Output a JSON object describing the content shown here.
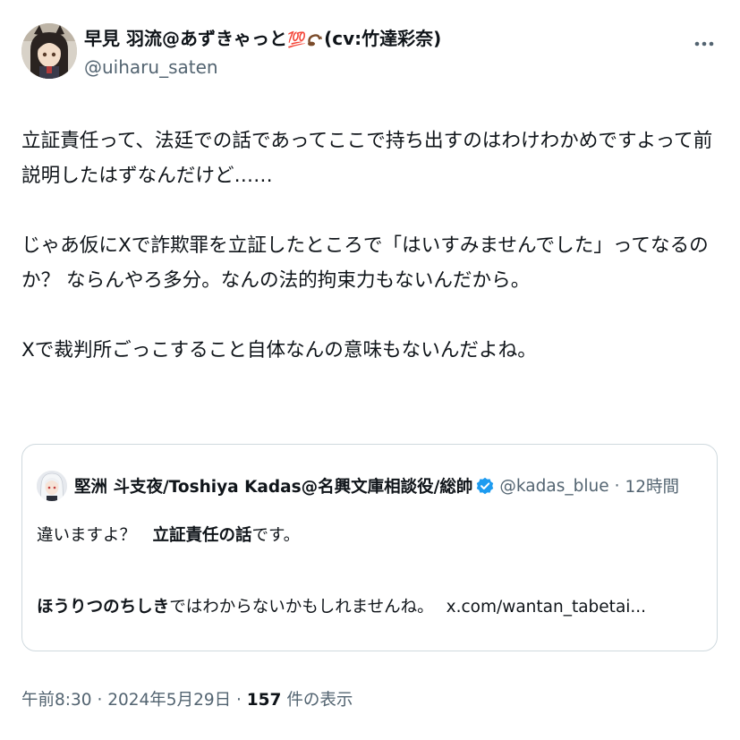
{
  "author": {
    "display_name": "早見 羽流@あずきゃっと",
    "name_emojis": "💯",
    "name_suffix": "(cv:竹達彩奈)",
    "handle": "@uiharu_saten"
  },
  "tweet": {
    "lines": [
      "立証責任って、法廷での話であってここで持ち出すのはわけわかめですよって前",
      "説明したはずなんだけど……",
      "",
      "じゃあ仮にXで詐欺罪を立証したところで「はいすみませんでした」ってなるの",
      "か？ ならんやろ多分。なんの法的拘束力もないんだから。",
      "",
      "Xで裁判所ごっこすること自体なんの意味もないんだよね。"
    ]
  },
  "quoted_tweet": {
    "display_name": "堅洲 斗支夜/Toshiya Kadas@名興文庫相談役/総帥",
    "handle": "@kadas_blue",
    "separator": "·",
    "time": "12時間",
    "line1_a": "違いますよ？　",
    "line1_b_bold": "立証責任の話",
    "line1_c": "です。",
    "line2_a_bold": "ほうりつのちしき",
    "line2_b": "ではわからないかもしれませんね。",
    "link": "x.com/wantan_tabetai..."
  },
  "footer": {
    "time": "午前8:30",
    "sep1": "·",
    "date": "2024年5月29日",
    "sep2": "·",
    "views_count": "157",
    "views_label": "件の表示"
  },
  "colors": {
    "text": "#0f1419",
    "secondary": "#536471",
    "border": "#cfd9de",
    "verified": "#1d9bf0"
  },
  "icons": {
    "more": "more-horizontal-icon",
    "verified": "verified-badge-icon"
  }
}
